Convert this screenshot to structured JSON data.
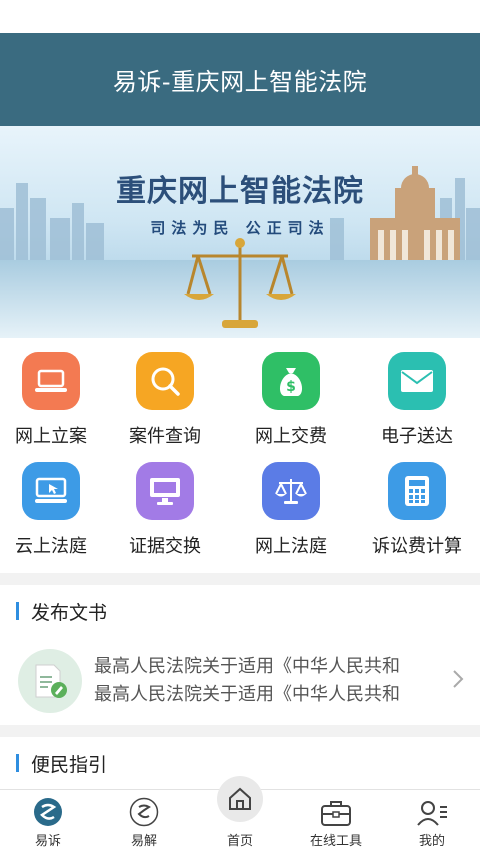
{
  "header": {
    "title": "易诉-重庆网上智能法院"
  },
  "banner": {
    "title": "重庆网上智能法院",
    "subtitle": "司法为民  公正司法"
  },
  "services": [
    {
      "label": "网上立案",
      "icon": "laptop-icon",
      "color": "#f37a52"
    },
    {
      "label": "案件查询",
      "icon": "search-icon",
      "color": "#f6a623"
    },
    {
      "label": "网上交费",
      "icon": "money-bag-icon",
      "color": "#2fbf66"
    },
    {
      "label": "电子送达",
      "icon": "mail-icon",
      "color": "#2bbfb1"
    },
    {
      "label": "云上法庭",
      "icon": "screen-cursor-icon",
      "color": "#3d9be6"
    },
    {
      "label": "证据交换",
      "icon": "monitor-icon",
      "color": "#a27be6"
    },
    {
      "label": "网上法庭",
      "icon": "scales-icon",
      "color": "#5b7ce6"
    },
    {
      "label": "诉讼费计算",
      "icon": "calculator-icon",
      "color": "#3d9be6"
    }
  ],
  "documents": {
    "heading": "发布文书",
    "items": [
      "最高人民法院关于适用《中华人民共和",
      "最高人民法院关于适用《中华人民共和"
    ]
  },
  "guide": {
    "heading": "便民指引"
  },
  "tabbar": [
    {
      "label": "易诉",
      "icon": "yisu-logo-icon"
    },
    {
      "label": "易解",
      "icon": "yijie-logo-icon"
    },
    {
      "label": "首页",
      "icon": "home-icon"
    },
    {
      "label": "在线工具",
      "icon": "briefcase-icon"
    },
    {
      "label": "我的",
      "icon": "user-icon"
    }
  ]
}
